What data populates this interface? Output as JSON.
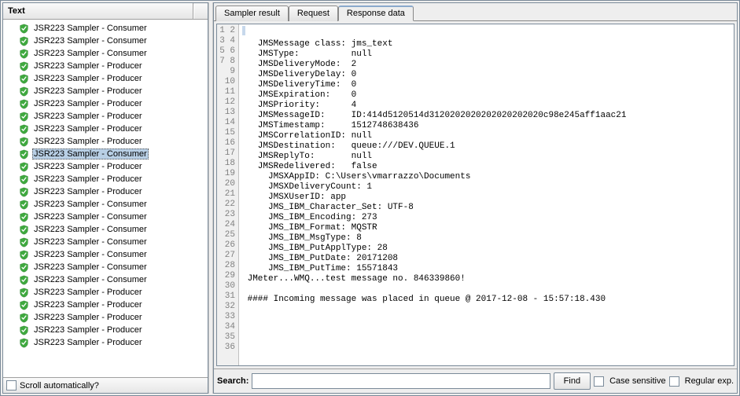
{
  "left_panel": {
    "header": "Text",
    "scroll_label": "Scroll automatically?",
    "items": [
      {
        "label": "JSR223 Sampler - Consumer",
        "selected": false
      },
      {
        "label": "JSR223 Sampler - Consumer",
        "selected": false
      },
      {
        "label": "JSR223 Sampler - Consumer",
        "selected": false
      },
      {
        "label": "JSR223 Sampler - Producer",
        "selected": false
      },
      {
        "label": "JSR223 Sampler - Producer",
        "selected": false
      },
      {
        "label": "JSR223 Sampler - Producer",
        "selected": false
      },
      {
        "label": "JSR223 Sampler - Producer",
        "selected": false
      },
      {
        "label": "JSR223 Sampler - Producer",
        "selected": false
      },
      {
        "label": "JSR223 Sampler - Producer",
        "selected": false
      },
      {
        "label": "JSR223 Sampler - Producer",
        "selected": false
      },
      {
        "label": "JSR223 Sampler - Consumer",
        "selected": true
      },
      {
        "label": "JSR223 Sampler - Producer",
        "selected": false
      },
      {
        "label": "JSR223 Sampler - Producer",
        "selected": false
      },
      {
        "label": "JSR223 Sampler - Producer",
        "selected": false
      },
      {
        "label": "JSR223 Sampler - Consumer",
        "selected": false
      },
      {
        "label": "JSR223 Sampler - Consumer",
        "selected": false
      },
      {
        "label": "JSR223 Sampler - Consumer",
        "selected": false
      },
      {
        "label": "JSR223 Sampler - Consumer",
        "selected": false
      },
      {
        "label": "JSR223 Sampler - Consumer",
        "selected": false
      },
      {
        "label": "JSR223 Sampler - Consumer",
        "selected": false
      },
      {
        "label": "JSR223 Sampler - Consumer",
        "selected": false
      },
      {
        "label": "JSR223 Sampler - Producer",
        "selected": false
      },
      {
        "label": "JSR223 Sampler - Producer",
        "selected": false
      },
      {
        "label": "JSR223 Sampler - Producer",
        "selected": false
      },
      {
        "label": "JSR223 Sampler - Producer",
        "selected": false
      },
      {
        "label": "JSR223 Sampler - Producer",
        "selected": false
      }
    ]
  },
  "tabs": [
    {
      "label": "Sampler result",
      "active": false
    },
    {
      "label": "Request",
      "active": false
    },
    {
      "label": "Response data",
      "active": true
    }
  ],
  "response_lines": [
    "",
    "   JMSMessage class: jms_text",
    "   JMSType:          null",
    "   JMSDeliveryMode:  2",
    "   JMSDeliveryDelay: 0",
    "   JMSDeliveryTime:  0",
    "   JMSExpiration:    0",
    "   JMSPriority:      4",
    "   JMSMessageID:     ID:414d5120514d3120202020202020202020c98e245aff1aac21",
    "   JMSTimestamp:     1512748638436",
    "   JMSCorrelationID: null",
    "   JMSDestination:   queue:///DEV.QUEUE.1",
    "   JMSReplyTo:       null",
    "   JMSRedelivered:   false",
    "     JMSXAppID: C:\\Users\\vmarrazzo\\Documents",
    "     JMSXDeliveryCount: 1",
    "     JMSXUserID: app",
    "     JMS_IBM_Character_Set: UTF-8",
    "     JMS_IBM_Encoding: 273",
    "     JMS_IBM_Format: MQSTR",
    "     JMS_IBM_MsgType: 8",
    "     JMS_IBM_PutApplType: 28",
    "     JMS_IBM_PutDate: 20171208",
    "     JMS_IBM_PutTime: 15571843",
    " JMeter...WMQ...test message no. 846339860!",
    " ",
    " #### Incoming message was placed in queue @ 2017-12-08 - 15:57:18.430"
  ],
  "total_gutter_lines": 36,
  "search": {
    "label": "Search:",
    "value": "",
    "find_label": "Find",
    "case_label": "Case sensitive",
    "regex_label": "Regular exp."
  }
}
